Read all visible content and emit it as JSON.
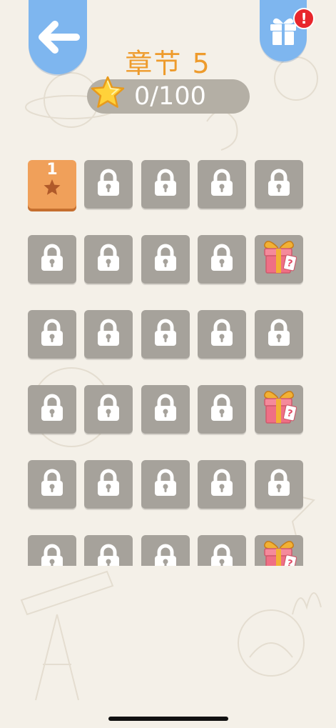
{
  "header": {
    "back_icon": "back-arrow-icon",
    "gift_icon": "gift-icon",
    "alert_badge": "!",
    "chapter_title": "章节 5"
  },
  "stars": {
    "icon": "star-icon",
    "count": "0/100"
  },
  "colors": {
    "background": "#f4f0e8",
    "tab_blue": "#7eb6ef",
    "locked_tile": "#a6a29b",
    "unlocked_tile": "#f0a05a",
    "title_orange": "#ee9b2c",
    "badge_red": "#e8262c"
  },
  "levels": [
    {
      "label": "1",
      "state": "unlocked",
      "stars": 1
    },
    {
      "state": "locked"
    },
    {
      "state": "locked"
    },
    {
      "state": "locked"
    },
    {
      "state": "locked"
    },
    {
      "state": "locked"
    },
    {
      "state": "locked"
    },
    {
      "state": "locked"
    },
    {
      "state": "locked"
    },
    {
      "state": "bonus-gift"
    },
    {
      "state": "locked"
    },
    {
      "state": "locked"
    },
    {
      "state": "locked"
    },
    {
      "state": "locked"
    },
    {
      "state": "locked"
    },
    {
      "state": "locked"
    },
    {
      "state": "locked"
    },
    {
      "state": "locked"
    },
    {
      "state": "locked"
    },
    {
      "state": "bonus-gift"
    },
    {
      "state": "locked"
    },
    {
      "state": "locked"
    },
    {
      "state": "locked"
    },
    {
      "state": "locked"
    },
    {
      "state": "locked"
    },
    {
      "state": "locked"
    },
    {
      "state": "locked"
    },
    {
      "state": "locked"
    },
    {
      "state": "locked"
    },
    {
      "state": "bonus-gift"
    }
  ]
}
